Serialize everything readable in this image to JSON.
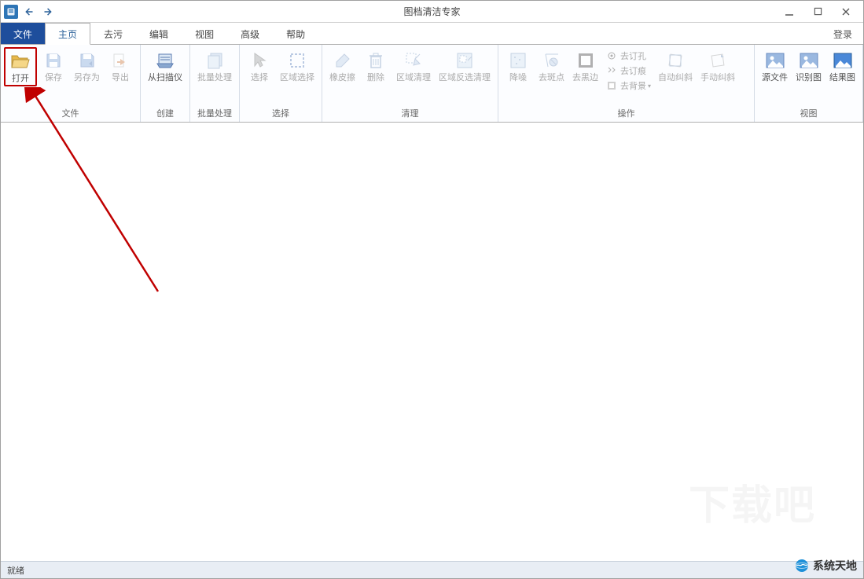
{
  "window": {
    "title": "图档清洁专家"
  },
  "tabs": {
    "file": "文件",
    "items": [
      "主页",
      "去污",
      "编辑",
      "视图",
      "高级",
      "帮助"
    ],
    "login": "登录",
    "active_index": 0
  },
  "ribbon": {
    "groups": [
      {
        "label": "文件",
        "buttons": [
          {
            "id": "open",
            "label": "打开",
            "enabled": true,
            "highlighted": true
          },
          {
            "id": "save",
            "label": "保存",
            "enabled": false
          },
          {
            "id": "saveas",
            "label": "另存为",
            "enabled": false
          },
          {
            "id": "export",
            "label": "导出",
            "enabled": false
          }
        ]
      },
      {
        "label": "创建",
        "buttons": [
          {
            "id": "fromscanner",
            "label": "从扫描仪",
            "enabled": true
          }
        ]
      },
      {
        "label": "批量处理",
        "buttons": [
          {
            "id": "batch",
            "label": "批量处理",
            "enabled": false
          }
        ]
      },
      {
        "label": "选择",
        "buttons": [
          {
            "id": "select",
            "label": "选择",
            "enabled": false
          },
          {
            "id": "areaselect",
            "label": "区域选择",
            "enabled": false
          }
        ]
      },
      {
        "label": "清理",
        "buttons": [
          {
            "id": "eraser",
            "label": "橡皮擦",
            "enabled": false
          },
          {
            "id": "delete",
            "label": "删除",
            "enabled": false
          },
          {
            "id": "areaclean",
            "label": "区域清理",
            "enabled": false
          },
          {
            "id": "areainvclean",
            "label": "区域反选清理",
            "enabled": false
          }
        ]
      },
      {
        "label": "操作",
        "buttons": [
          {
            "id": "denoise",
            "label": "降噪",
            "enabled": false
          },
          {
            "id": "despeckle",
            "label": "去斑点",
            "enabled": false
          },
          {
            "id": "deblack",
            "label": "去黑边",
            "enabled": false
          }
        ],
        "small": [
          {
            "id": "depunch",
            "label": "去订孔"
          },
          {
            "id": "destitch",
            "label": "去订痕"
          },
          {
            "id": "debg",
            "label": "去背景",
            "dropdown": true
          }
        ],
        "extra": [
          {
            "id": "autodeskew",
            "label": "自动纠斜",
            "enabled": false
          },
          {
            "id": "manualdeskew",
            "label": "手动纠斜",
            "enabled": false
          }
        ]
      },
      {
        "label": "视图",
        "buttons": [
          {
            "id": "srcimg",
            "label": "源文件",
            "enabled": true
          },
          {
            "id": "recogimg",
            "label": "识别图",
            "enabled": true
          },
          {
            "id": "resultimg",
            "label": "结果图",
            "enabled": true,
            "accent": true
          }
        ]
      }
    ]
  },
  "status": {
    "text": "就绪"
  },
  "watermark": {
    "text": "系统天地"
  }
}
